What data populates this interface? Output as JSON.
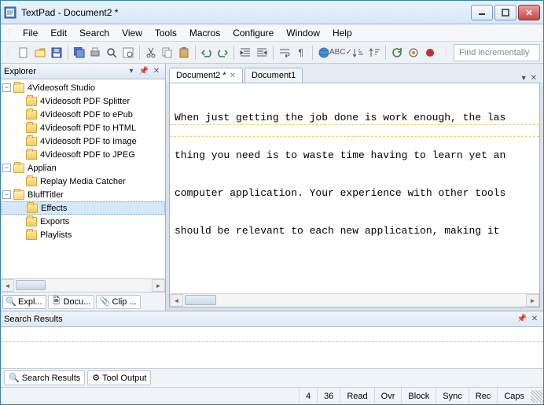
{
  "window": {
    "title": "TextPad - Document2 *"
  },
  "menu": {
    "items": [
      "File",
      "Edit",
      "Search",
      "View",
      "Tools",
      "Macros",
      "Configure",
      "Window",
      "Help"
    ]
  },
  "findBox": {
    "placeholder": "Find incrementally"
  },
  "explorer": {
    "title": "Explorer",
    "tree": [
      {
        "label": "4Videosoft Studio",
        "expanded": true,
        "depth": 0,
        "children": [
          {
            "label": "4Videosoft PDF Splitter",
            "depth": 1
          },
          {
            "label": "4Videosoft PDF to ePub",
            "depth": 1
          },
          {
            "label": "4Videosoft PDF to HTML",
            "depth": 1
          },
          {
            "label": "4Videosoft PDF to Image",
            "depth": 1
          },
          {
            "label": "4Videosoft PDF to JPEG",
            "depth": 1
          }
        ]
      },
      {
        "label": "Applian",
        "expanded": true,
        "depth": 0,
        "children": [
          {
            "label": "Replay Media Catcher",
            "depth": 1
          }
        ]
      },
      {
        "label": "BluffTitler",
        "expanded": true,
        "depth": 0,
        "children": [
          {
            "label": "Effects",
            "depth": 1,
            "selected": true
          },
          {
            "label": "Exports",
            "depth": 1
          },
          {
            "label": "Playlists",
            "depth": 1
          }
        ]
      }
    ],
    "tabs": [
      {
        "label": "Expl...",
        "active": true,
        "icon": "magnifier"
      },
      {
        "label": "Docu...",
        "active": false,
        "icon": "doc"
      },
      {
        "label": "Clip ...",
        "active": false,
        "icon": "clip"
      }
    ]
  },
  "docTabs": [
    {
      "label": "Document2 *",
      "active": true
    },
    {
      "label": "Document1",
      "active": false
    }
  ],
  "editor": {
    "lines": [
      "When just getting the job done is work enough, the las",
      "thing you need is to waste time having to learn yet an",
      "computer application. Your experience with other tools",
      "should be relevant to each new application, making it "
    ]
  },
  "searchPanel": {
    "title": "Search Results",
    "tabs": [
      {
        "label": "Search Results",
        "active": true
      },
      {
        "label": "Tool Output",
        "active": false
      }
    ]
  },
  "status": {
    "line": "4",
    "col": "36",
    "cells": [
      "Read",
      "Ovr",
      "Block",
      "Sync",
      "Rec",
      "Caps"
    ]
  }
}
